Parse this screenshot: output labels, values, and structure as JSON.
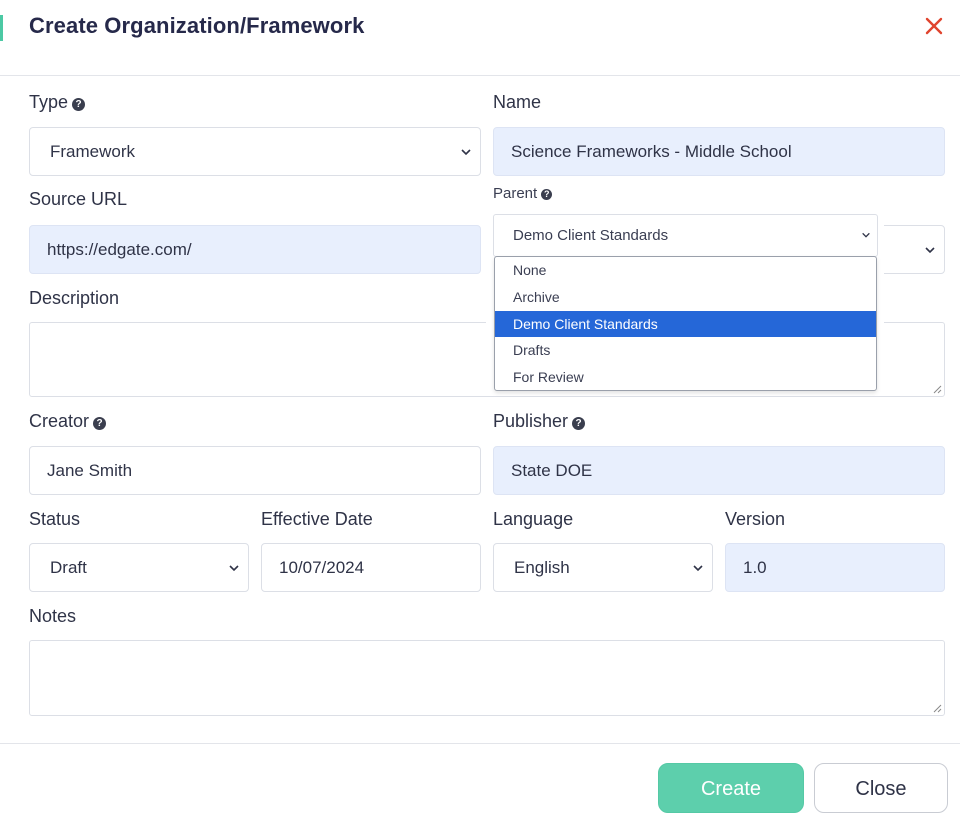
{
  "dialog": {
    "title": "Create Organization/Framework",
    "close_icon": "close-x-icon"
  },
  "fields": {
    "type": {
      "label": "Type",
      "value": "Framework"
    },
    "name": {
      "label": "Name",
      "value": "Science Frameworks - Middle School"
    },
    "source_url": {
      "label": "Source URL",
      "value": "https://edgate.com/"
    },
    "parent": {
      "label": "Parent",
      "value": "Demo Client Standards",
      "options": [
        "None",
        "Archive",
        "Demo Client Standards",
        "Drafts",
        "For Review"
      ],
      "selected_index": 2
    },
    "description": {
      "label": "Description",
      "value": ""
    },
    "creator": {
      "label": "Creator",
      "value": "Jane Smith"
    },
    "publisher": {
      "label": "Publisher",
      "value": "State DOE"
    },
    "status": {
      "label": "Status",
      "value": "Draft"
    },
    "effective_date": {
      "label": "Effective Date",
      "value": "10/07/2024"
    },
    "language": {
      "label": "Language",
      "value": "English"
    },
    "version": {
      "label": "Version",
      "value": "1.0"
    },
    "notes": {
      "label": "Notes",
      "value": ""
    }
  },
  "buttons": {
    "create": "Create",
    "close": "Close"
  },
  "colors": {
    "accent": "#4cc9a4",
    "create_button": "#5dcfac",
    "close_icon": "#e0442e",
    "selected_option": "#2567d8",
    "filled_field": "#e8effd"
  }
}
